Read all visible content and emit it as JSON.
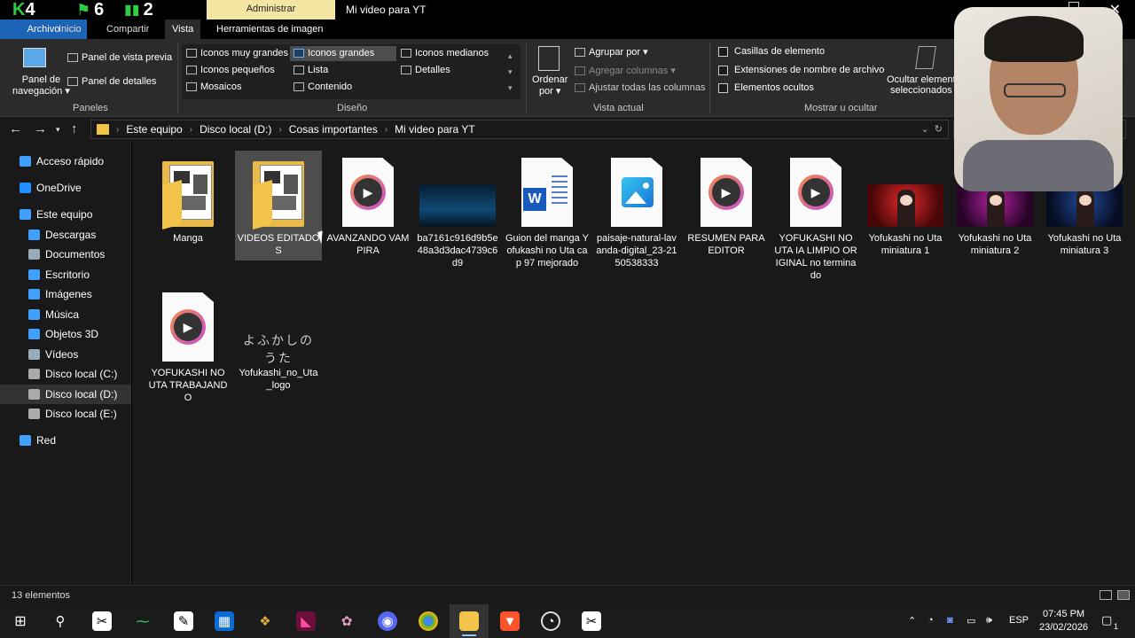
{
  "titlebar": {
    "counter_k": "4",
    "counter_a": "6",
    "counter_b": "2",
    "contextual_tab": "Administrar",
    "window_title": "Mi video para YT",
    "close_glyph": "✕"
  },
  "tabs": {
    "file": "Archivo",
    "home": "Inicio",
    "share": "Compartir",
    "view": "Vista",
    "image_tools": "Herramientas de imagen"
  },
  "ribbon": {
    "panes": {
      "nav_pane_line1": "Panel de",
      "nav_pane_line2": "navegación ▾",
      "preview_pane": "Panel de vista previa",
      "details_pane": "Panel de detalles",
      "group_label": "Paneles"
    },
    "layout": {
      "extra_large": "Iconos muy grandes",
      "large": "Iconos grandes",
      "medium": "Iconos medianos",
      "small": "Iconos pequeños",
      "list": "Lista",
      "details": "Detalles",
      "tiles": "Mosaicos",
      "content": "Contenido",
      "group_label": "Diseño"
    },
    "current_view": {
      "sort_line1": "Ordenar",
      "sort_line2": "por ▾",
      "group_by": "Agrupar por ▾",
      "add_columns": "Agregar columnas ▾",
      "fit_columns": "Ajustar todas las columnas",
      "group_label": "Vista actual"
    },
    "show_hide": {
      "item_checkboxes": "Casillas de elemento",
      "file_extensions": "Extensiones de nombre de archivo",
      "hidden_items": "Elementos ocultos",
      "hide_selected_line1": "Ocultar element",
      "hide_selected_line2": "seleccionados",
      "group_label": "Mostrar u ocultar"
    }
  },
  "address": {
    "crumbs": [
      "Este equipo",
      "Disco local (D:)",
      "Cosas importantes",
      "Mi video para YT"
    ],
    "sep": "›"
  },
  "sidebar": {
    "items": [
      {
        "label": "Acceso rápido",
        "icon": "star-icon"
      },
      {
        "label": "OneDrive",
        "icon": "cloud-icon"
      },
      {
        "label": "Este equipo",
        "icon": "computer-icon"
      },
      {
        "label": "Descargas",
        "icon": "download-icon"
      },
      {
        "label": "Documentos",
        "icon": "document-icon"
      },
      {
        "label": "Escritorio",
        "icon": "desktop-icon"
      },
      {
        "label": "Imágenes",
        "icon": "pictures-icon"
      },
      {
        "label": "Música",
        "icon": "music-icon"
      },
      {
        "label": "Objetos 3D",
        "icon": "cube-icon"
      },
      {
        "label": "Vídeos",
        "icon": "video-icon"
      },
      {
        "label": "Disco local (C:)",
        "icon": "drive-icon"
      },
      {
        "label": "Disco local (D:)",
        "icon": "drive-icon"
      },
      {
        "label": "Disco local (E:)",
        "icon": "drive-icon"
      },
      {
        "label": "Red",
        "icon": "network-icon"
      }
    ],
    "selected_index": 11
  },
  "files": [
    {
      "name": "Manga",
      "kind": "folder"
    },
    {
      "name": "VIDEOS EDITADOS",
      "kind": "folder",
      "selected": true
    },
    {
      "name": "AVANZANDO VAMPIRA",
      "kind": "video"
    },
    {
      "name": "ba7161c916d9b5e48a3d3dac4739c6d9",
      "kind": "photo-blue"
    },
    {
      "name": "Guion del manga Yofukashi no Uta cap 97 mejorado",
      "kind": "word"
    },
    {
      "name": "paisaje-natural-lavanda-digital_23-2150538333",
      "kind": "image"
    },
    {
      "name": "RESUMEN PARA EDITOR",
      "kind": "video"
    },
    {
      "name": "YOFUKASHI NO UTA IA LIMPIO ORIGINAL no terminado",
      "kind": "video"
    },
    {
      "name": "Yofukashi no Uta miniatura 1",
      "kind": "photo-red"
    },
    {
      "name": "Yofukashi no Uta miniatura 2",
      "kind": "photo-purple"
    },
    {
      "name": "Yofukashi no Uta miniatura 3",
      "kind": "photo-blue2"
    },
    {
      "name": "YOFUKASHI NO UTA TRABAJANDO",
      "kind": "video"
    },
    {
      "name": "Yofukashi_no_Uta_logo",
      "kind": "logo"
    }
  ],
  "logo_text": "よふかしのうた",
  "status": {
    "count": "13 elementos"
  },
  "taskbar": {
    "lang": "ESP",
    "time": "07:45 PM",
    "date": "23/02/2026",
    "notification_count": "1"
  }
}
